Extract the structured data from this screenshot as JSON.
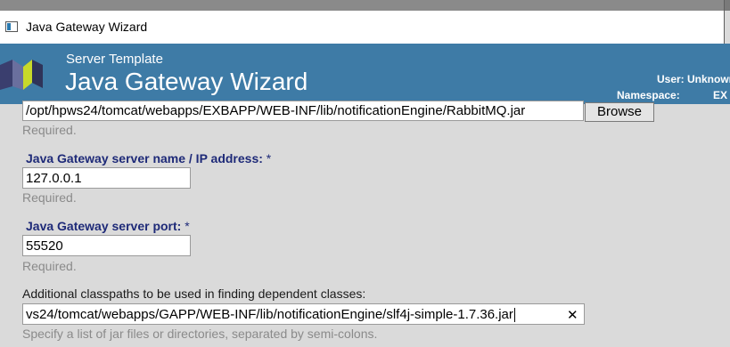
{
  "window": {
    "title": "Java Gateway Wizard"
  },
  "header": {
    "subtitle": "Server Template",
    "title": "Java Gateway Wizard",
    "user_label": "User: Unknown",
    "namespace_label": "Namespace:",
    "namespace_value": "EX"
  },
  "jar_field": {
    "value": "/opt/hpws24/tomcat/webapps/EXBAPP/WEB-INF/lib/notificationEngine/RabbitMQ.jar",
    "browse_label": "Browse",
    "hint": "Required."
  },
  "server_name": {
    "label": "Java Gateway server name / IP address:",
    "required_mark": "*",
    "value": "127.0.0.1",
    "hint": "Required."
  },
  "server_port": {
    "label": "Java Gateway server port:",
    "required_mark": "*",
    "value": "55520",
    "hint": "Required."
  },
  "classpath": {
    "label": "Additional classpaths to be used in finding dependent classes:",
    "value": "vs24/tomcat/webapps/GAPP/WEB-INF/lib/notificationEngine/slf4j-simple-1.7.36.jar",
    "clear_glyph": "✕",
    "hint": "Specify a list of jar files or directories, separated by semi-colons."
  },
  "colors": {
    "header_bg": "#3e7ba6",
    "label_color": "#1e2a78",
    "hint_color": "#8a8a8a"
  }
}
